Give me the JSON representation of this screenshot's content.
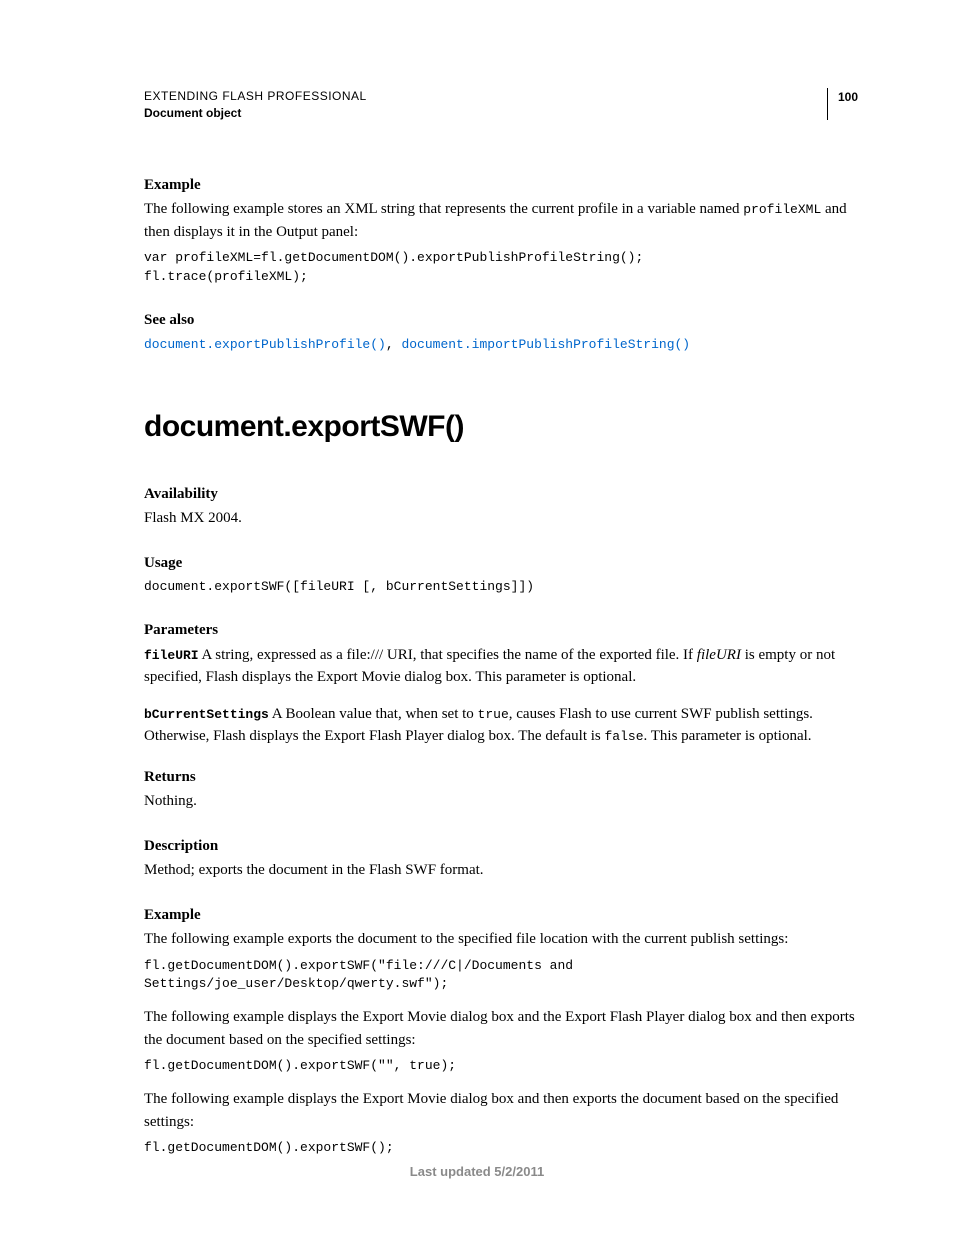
{
  "header": {
    "title": "EXTENDING FLASH PROFESSIONAL",
    "subtitle": "Document object",
    "page": "100"
  },
  "example1": {
    "heading": "Example",
    "text_a": "The following example stores an XML string that represents the current profile in a variable named ",
    "text_code": "profileXML",
    "text_b": " and then displays it in the Output panel:",
    "code": "var profileXML=fl.getDocumentDOM().exportPublishProfileString(); \nfl.trace(profileXML);"
  },
  "seealso": {
    "heading": "See also",
    "link1": "document.exportPublishProfile()",
    "sep": ", ",
    "link2": "document.importPublishProfileString()"
  },
  "method": {
    "title": "document.exportSWF()"
  },
  "availability": {
    "heading": "Availability",
    "text": "Flash MX 2004."
  },
  "usage": {
    "heading": "Usage",
    "code": "document.exportSWF([fileURI [, bCurrentSettings]])"
  },
  "parameters": {
    "heading": "Parameters",
    "p1_name": "fileURI",
    "p1_a": "  A string, expressed as a file:/// URI, that specifies the name of the exported file. If ",
    "p1_it": "fileURI",
    "p1_b": " is empty or not specified, Flash displays the Export Movie dialog box. This parameter is optional.",
    "p2_name": "bCurrentSettings",
    "p2_a": "  A Boolean value that, when set to ",
    "p2_code1": "true",
    "p2_b": ", causes Flash to use current SWF publish settings. Otherwise, Flash displays the Export Flash Player dialog box. The default is ",
    "p2_code2": "false",
    "p2_c": ". This parameter is optional."
  },
  "returns": {
    "heading": "Returns",
    "text": "Nothing."
  },
  "description": {
    "heading": "Description",
    "text": "Method; exports the document in the Flash SWF format."
  },
  "example2": {
    "heading": "Example",
    "t1": "The following example exports the document to the specified file location with the current publish settings:",
    "c1": "fl.getDocumentDOM().exportSWF(\"file:///C|/Documents and \nSettings/joe_user/Desktop/qwerty.swf\");",
    "t2": "The following example displays the Export Movie dialog box and the Export Flash Player dialog box and then exports the document based on the specified settings:",
    "c2": "fl.getDocumentDOM().exportSWF(\"\", true);",
    "t3": "The following example displays the Export Movie dialog box and then exports the document based on the specified settings:",
    "c3": "fl.getDocumentDOM().exportSWF();"
  },
  "footer": {
    "text": "Last updated 5/2/2011"
  }
}
